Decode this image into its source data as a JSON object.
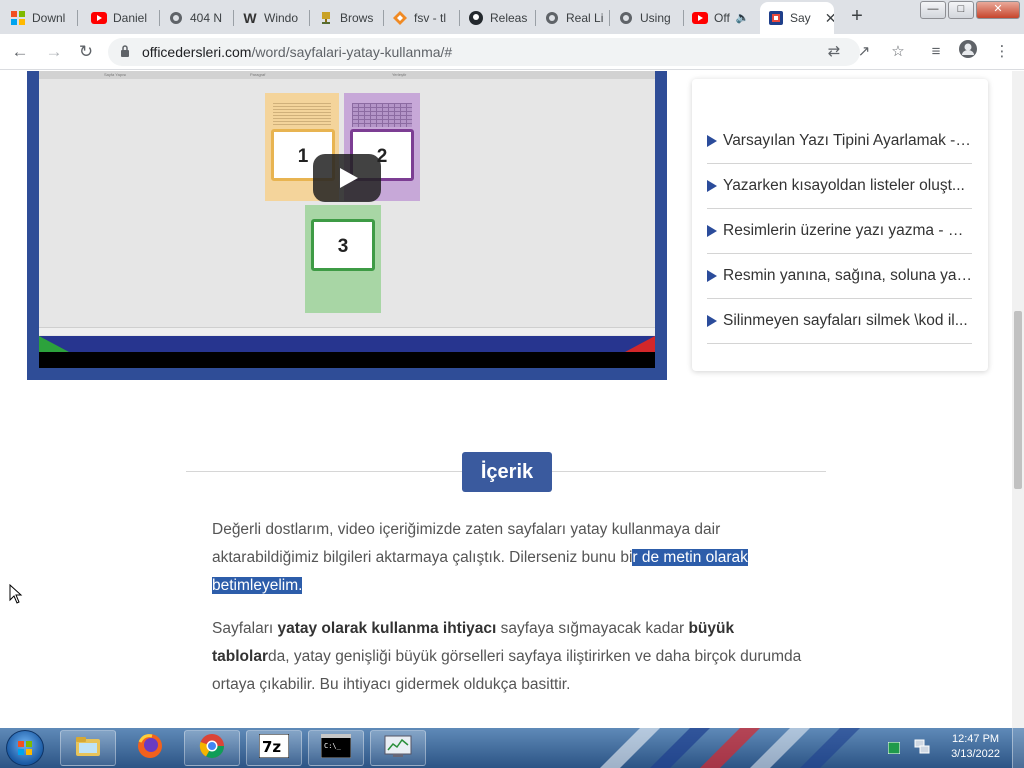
{
  "browser": {
    "tabs": [
      {
        "label": "Downl",
        "icon": "microsoft-logo-icon"
      },
      {
        "label": "Daniel",
        "icon": "youtube-icon"
      },
      {
        "label": "404 N",
        "icon": "globe-icon"
      },
      {
        "label": "Windo",
        "icon": "w-logo-icon"
      },
      {
        "label": "Brows",
        "icon": "trophy-icon"
      },
      {
        "label": "fsv - tl",
        "icon": "diamond-icon"
      },
      {
        "label": "Releas",
        "icon": "github-icon"
      },
      {
        "label": "Real Li",
        "icon": "globe-icon"
      },
      {
        "label": "Using",
        "icon": "globe-icon"
      },
      {
        "label": "Off",
        "icon": "youtube-icon"
      },
      {
        "label": "Say",
        "icon": "officedersleri-icon",
        "active": true
      }
    ],
    "new_tab": "+",
    "url_domain": "officedersleri.com",
    "url_path": "/word/sayfalari-yatay-kullanma/#"
  },
  "video": {
    "ruler_labels": [
      "Sayfa Yapısı",
      "Paragraf",
      "Yerleştir"
    ],
    "page_numbers": [
      "1",
      "2",
      "3"
    ]
  },
  "sidebar": {
    "related_posts": [
      "Varsayılan Yazı Tipini Ayarlamak - ...",
      "Yazarken kısayoldan listeler oluşt...",
      "Resimlerin üzerine yazı yazma - M...",
      "Resmin yanına, sağına, soluna yaz...",
      "Silinmeyen sayfaları silmek \\kod il..."
    ]
  },
  "content": {
    "toc_label": "İçerik",
    "p1_a": "Değerli dostlarım, video içeriğimizde zaten sayfaları yatay kullanmaya dair aktarabildiğimiz bilgileri aktarmaya çalıştık. Dilerseniz bunu bi",
    "p1_sel": "r de metin olarak betimleyelim.",
    "p2_a": "Sayfaları ",
    "p2_b1": "yatay olarak kullanma ihtiyacı",
    "p2_c": " sayfaya sığmayacak kadar ",
    "p2_b2": "büyük tablolar",
    "p2_d": "da, yatay genişliği büyük görselleri sayfaya iliştirirken ve daha birçok durumda ortaya çıkabilir. Bu ihtiyacı gidermek oldukça basittir."
  },
  "taskbar": {
    "apps": [
      "windows-explorer",
      "firefox",
      "chrome",
      "7zip",
      "command-prompt",
      "task-manager"
    ],
    "time": "12:47 PM",
    "date": "3/13/2022"
  },
  "colors": {
    "accent": "#3a5a9e",
    "selection": "#2d5daa",
    "video_border": "#2f4d97"
  }
}
